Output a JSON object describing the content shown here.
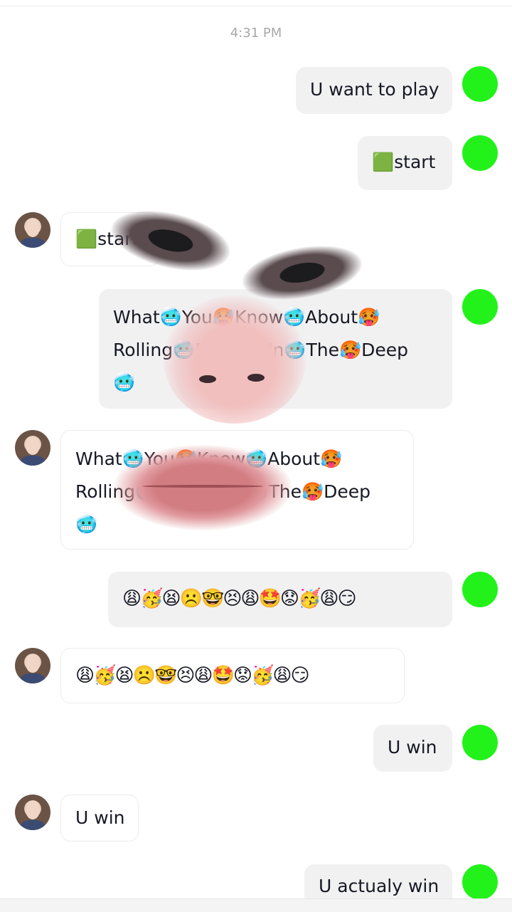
{
  "timestamp": "4:31 PM",
  "colors": {
    "accent_dot": "#22f21a",
    "out_bubble": "#f1f1f2"
  },
  "messages": [
    {
      "side": "out",
      "text": "U want to play"
    },
    {
      "side": "out",
      "text": "🟩start"
    },
    {
      "side": "in",
      "text": "🟩start"
    },
    {
      "side": "out",
      "text": "What🥶You🥵Know🥶About🥵Rolling🥶Down🥵In🥶The🥵Deep🥶"
    },
    {
      "side": "in",
      "text": "What🥶You🥵Know🥶About🥵Rolling🥶Down🥵In🥶The🥵Deep🥶"
    },
    {
      "side": "out",
      "text": "😩🥳😫☹️🤓😣😩🤩😟🥳😩😏"
    },
    {
      "side": "in",
      "text": "😩🥳😫☹️🤓😣😩🤩😟🥳😩😏"
    },
    {
      "side": "out",
      "text": "U win"
    },
    {
      "side": "in",
      "text": "U win"
    },
    {
      "side": "out",
      "text": "U actualy win"
    }
  ],
  "lines": {
    "msg3": [
      "What🥶You🥵Know🥶About🥵",
      "Rolling🥶Down🥵In🥶The🥵Deep",
      "🥶"
    ],
    "msg4": [
      "What🥶You🥵Know🥶About🥵",
      "Rolling🥶Down🥵In🥶The🥵Deep",
      "🥶"
    ]
  },
  "icons": {
    "user_avatar": "avatar",
    "self_avatar": "green-dot"
  }
}
